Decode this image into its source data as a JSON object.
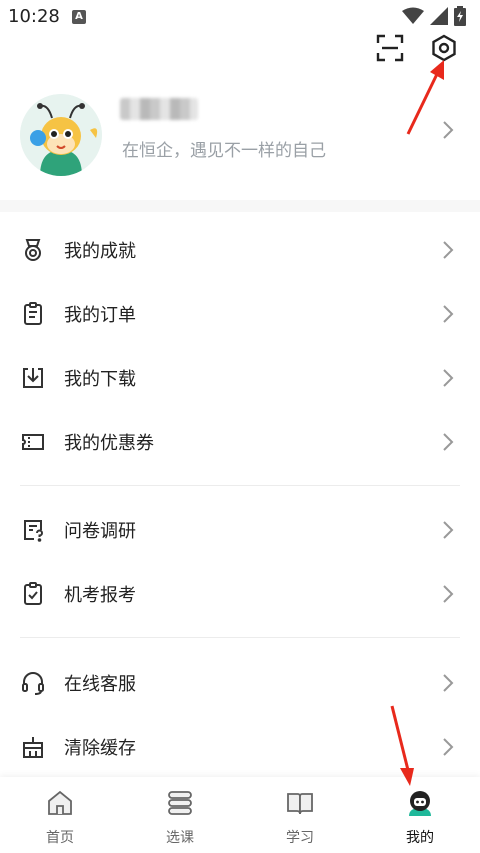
{
  "status_bar": {
    "time": "10:28",
    "indicator": "A",
    "icons": [
      "wifi-icon",
      "signal-icon",
      "battery-icon"
    ]
  },
  "top_actions": {
    "scan_icon": "scan-icon",
    "settings_icon": "settings-icon"
  },
  "profile": {
    "username": "",
    "slogan": "在恒企，遇见不一样的自己"
  },
  "menu_group_1": [
    {
      "label": "我的成就",
      "icon": "medal-icon"
    },
    {
      "label": "我的订单",
      "icon": "clipboard-icon"
    },
    {
      "label": "我的下载",
      "icon": "download-icon"
    },
    {
      "label": "我的优惠券",
      "icon": "coupon-icon"
    }
  ],
  "menu_group_2": [
    {
      "label": "问卷调研",
      "icon": "survey-icon"
    },
    {
      "label": "机考报考",
      "icon": "exam-icon"
    }
  ],
  "menu_group_3": [
    {
      "label": "在线客服",
      "icon": "headset-icon"
    },
    {
      "label": "清除缓存",
      "icon": "broom-icon"
    }
  ],
  "tabbar": {
    "tabs": [
      {
        "label": "首页",
        "icon": "home-icon"
      },
      {
        "label": "选课",
        "icon": "courses-icon"
      },
      {
        "label": "学习",
        "icon": "book-icon"
      },
      {
        "label": "我的",
        "icon": "profile-icon"
      }
    ],
    "active_index": 3
  },
  "colors": {
    "accent": "#1fb89a",
    "annotation_arrow": "#e8291c",
    "slogan_text": "#9aa0a6"
  }
}
